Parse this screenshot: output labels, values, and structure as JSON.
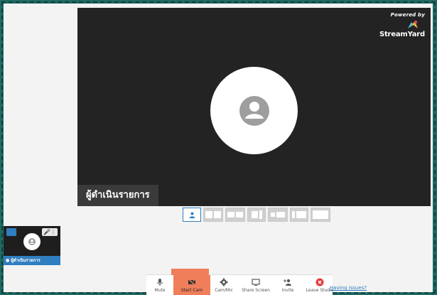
{
  "stage": {
    "brand_powered_by": "Powered by",
    "brand_name": "StreamYard",
    "speaker_name": "ผู้ดำเนินรายการ"
  },
  "layouts": {
    "count": 7,
    "active_index": 0
  },
  "participant": {
    "name": "ผู้ดำเนินรายการ"
  },
  "toolbar": {
    "items": [
      {
        "label": "Mute",
        "icon": "microphone-icon"
      },
      {
        "label": "Start Cam",
        "icon": "camera-off-icon"
      },
      {
        "label": "Cam/Mic",
        "icon": "gear-icon"
      },
      {
        "label": "Share Screen",
        "icon": "monitor-icon"
      },
      {
        "label": "Invite",
        "icon": "add-user-icon"
      },
      {
        "label": "Leave Studio",
        "icon": "close-circle-icon"
      }
    ],
    "help_link": "Having issues?"
  },
  "colors": {
    "accent": "#2f7ec0",
    "highlight": "#f07e5a",
    "leave": "#e23c3c"
  }
}
